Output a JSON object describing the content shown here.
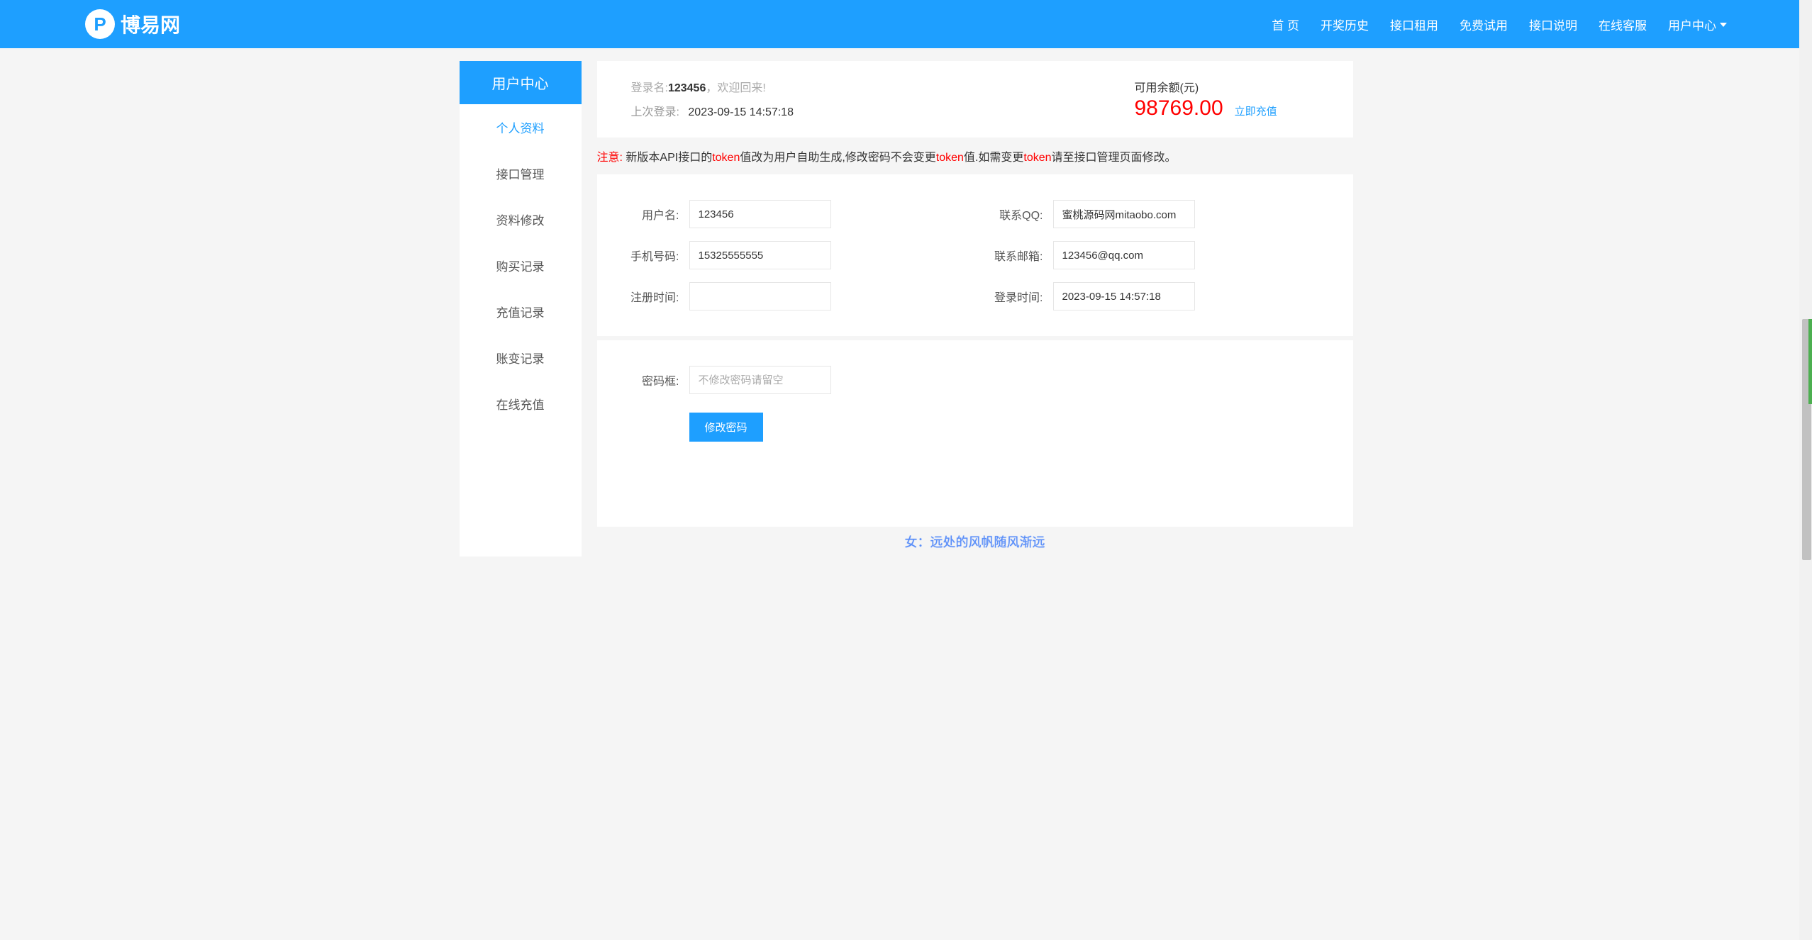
{
  "site": {
    "name": "博易网"
  },
  "nav": {
    "home": "首 页",
    "history": "开奖历史",
    "rent": "接口租用",
    "free_trial": "免费试用",
    "api_doc": "接口说明",
    "support": "在线客服",
    "user_center": "用户中心"
  },
  "sidebar": {
    "header": "用户中心",
    "items": [
      "个人资料",
      "接口管理",
      "资料修改",
      "购买记录",
      "充值记录",
      "账变记录",
      "在线充值"
    ]
  },
  "account": {
    "login_name_label": "登录名:",
    "login_name": "123456",
    "welcome": "，欢迎回来!",
    "last_login_label": "上次登录:",
    "last_login": "2023-09-15 14:57:18",
    "balance_label": "可用余额(元)",
    "balance": "98769.00",
    "recharge": "立即充值"
  },
  "notice": {
    "label": "注意: ",
    "p1": "新版本API接口的",
    "t1": "token",
    "p2": "值改为用户自助生成,修改密码不会变更",
    "t2": "token",
    "p3": "值.如需变更",
    "t3": "token",
    "p4": "请至接口管理页面修改。"
  },
  "form": {
    "username_label": "用户名:",
    "username": "123456",
    "qq_label": "联系QQ:",
    "qq": "蜜桃源码网mitaobo.com",
    "phone_label": "手机号码:",
    "phone": "15325555555",
    "email_label": "联系邮箱:",
    "email": "123456@qq.com",
    "regtime_label": "注册时间:",
    "regtime": "",
    "logintime_label": "登录时间:",
    "logintime": "2023-09-15 14:57:18"
  },
  "password": {
    "label": "密码框:",
    "placeholder": "不修改密码请留空",
    "button": "修改密码"
  },
  "lyric": "女：远处的风帆随风渐远"
}
